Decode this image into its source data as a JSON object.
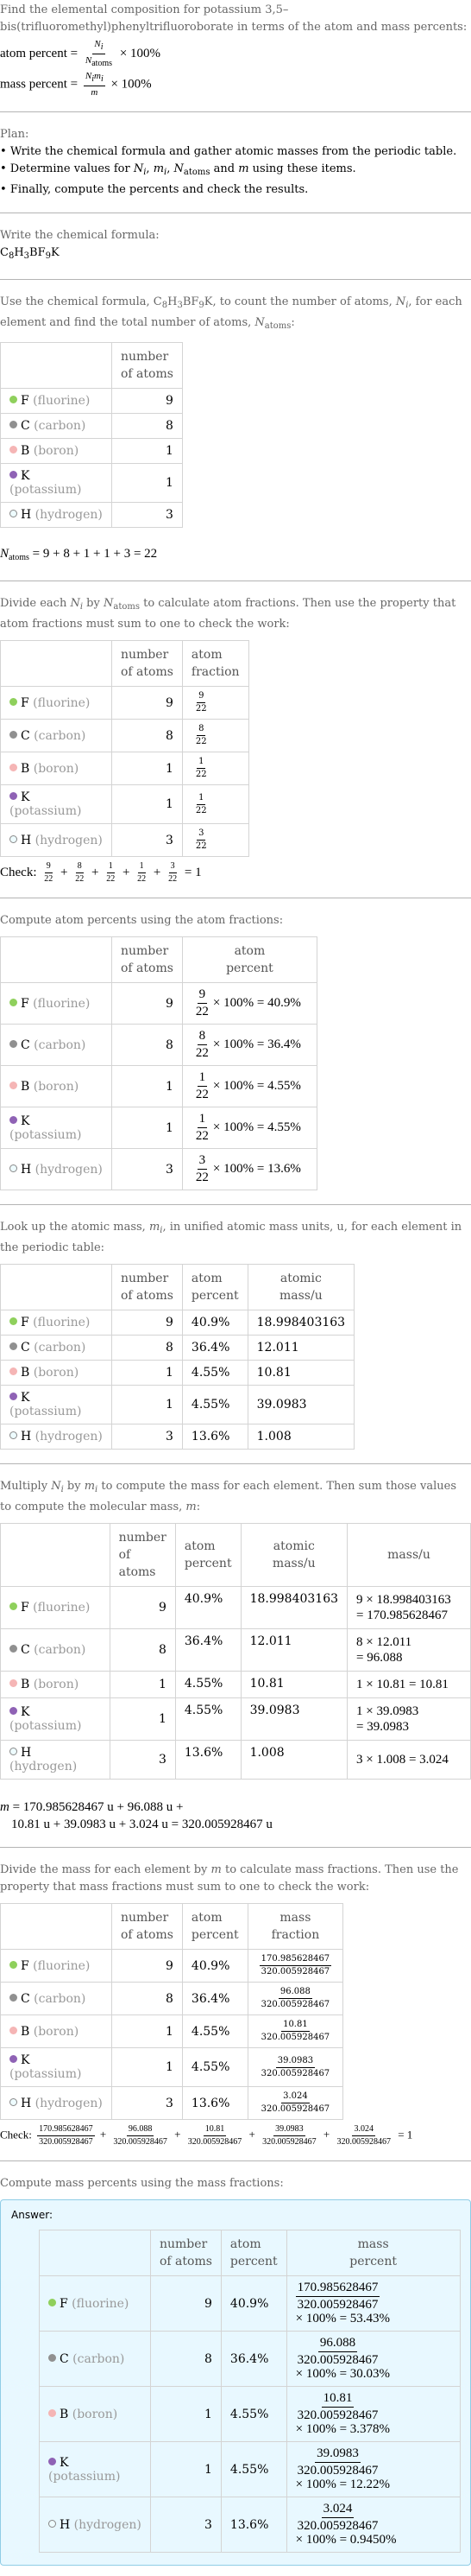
{
  "intro": {
    "question": "Find the elemental composition for potassium 3,5–bis(trifluoromethyl)phenyltrifluoroborate in terms of the atom and mass percents:",
    "atom_percent_label": "atom percent = ",
    "mass_percent_label": "mass percent = ",
    "times_100": " × 100%"
  },
  "plan": {
    "title": "Plan:",
    "items": [
      "Write the chemical formula and gather atomic masses from the periodic table.",
      "Determine values for Nᵢ, mᵢ, N_atoms and m using these items.",
      "Finally, compute the percents and check the results."
    ]
  },
  "formula_step": {
    "label": "Write the chemical formula:",
    "formula": "C8H3BF9K"
  },
  "count_step": {
    "text_a": "Use the chemical formula, ",
    "text_b": ", to count the number of atoms, ",
    "text_c": ", for each element and find the total number of atoms, ",
    "text_d": ":",
    "total_equation": " = 9 + 8 + 1 + 1 + 3 = 22"
  },
  "headers": {
    "number_of_atoms_1": "number",
    "number_of_atoms_2": "of atoms",
    "atom_fraction_1": "atom",
    "atom_fraction_2": "fraction",
    "atom_percent_1": "atom",
    "atom_percent_2": "percent",
    "atomic_mass_1": "atomic",
    "atomic_mass_2": "mass/u",
    "mass": "mass/u",
    "mass_fraction_1": "mass",
    "mass_fraction_2": "fraction",
    "mass_percent_1": "mass",
    "mass_percent_2": "percent"
  },
  "elements": [
    {
      "symbol": "F",
      "name": "(fluorine)",
      "color": "#8fd05c",
      "count": "9",
      "frac_n": "9",
      "frac_d": "22",
      "atom_percent_eq": "× 100% = 40.9%",
      "atom_percent": "40.9%",
      "atomic_mass": "18.998403163",
      "mass_eq_1": "9 × 18.998403163",
      "mass_eq_2": "= 170.985628467",
      "mass": "170.985628467",
      "mass_percent_eq": "× 100% = 53.43%"
    },
    {
      "symbol": "C",
      "name": "(carbon)",
      "color": "#909090",
      "count": "8",
      "frac_n": "8",
      "frac_d": "22",
      "atom_percent_eq": "× 100% = 36.4%",
      "atom_percent": "36.4%",
      "atomic_mass": "12.011",
      "mass_eq_1": "8 × 12.011",
      "mass_eq_2": "= 96.088",
      "mass": "96.088",
      "mass_percent_eq": "× 100% = 30.03%"
    },
    {
      "symbol": "B",
      "name": "(boron)",
      "color": "#f5b5b5",
      "count": "1",
      "frac_n": "1",
      "frac_d": "22",
      "atom_percent_eq": "× 100% = 4.55%",
      "atom_percent": "4.55%",
      "atomic_mass": "10.81",
      "mass_eq_1": "1 × 10.81 = 10.81",
      "mass_eq_2": "",
      "mass": "10.81",
      "mass_percent_eq": "× 100% = 3.378%"
    },
    {
      "symbol": "K",
      "name": "(potassium)",
      "color": "#8f62b5",
      "count": "1",
      "frac_n": "1",
      "frac_d": "22",
      "atom_percent_eq": "× 100% = 4.55%",
      "atom_percent": "4.55%",
      "atomic_mass": "39.0983",
      "mass_eq_1": "1 × 39.0983",
      "mass_eq_2": "= 39.0983",
      "mass": "39.0983",
      "mass_percent_eq": "× 100% = 12.22%"
    },
    {
      "symbol": "H",
      "name": "(hydrogen)",
      "color": "#eefcff",
      "count": "3",
      "frac_n": "3",
      "frac_d": "22",
      "atom_percent_eq": "× 100% = 13.6%",
      "atom_percent": "13.6%",
      "atomic_mass": "1.008",
      "mass_eq_1": "3 × 1.008 = 3.024",
      "mass_eq_2": "",
      "mass": "3.024",
      "mass_percent_eq": "× 100% = 0.9450%"
    }
  ],
  "fraction_step": {
    "text_a": "Divide each ",
    "text_b": " by ",
    "text_c": " to calculate atom fractions. Then use the property that atom fractions must sum to one to check the work:",
    "check_label": "Check: ",
    "check_result": " = 1"
  },
  "atom_percent_step": {
    "text": "Compute atom percents using the atom fractions:"
  },
  "mass_lookup_step": {
    "text_a": "Look up the atomic mass, ",
    "text_b": ", in unified atomic mass units, u, for each element in the periodic table:"
  },
  "mass_step": {
    "text_a": "Multiply ",
    "text_b": " by ",
    "text_c": " to compute the mass for each element. Then sum those values to compute the molecular mass, ",
    "text_d": ":",
    "total_line_1": " = 170.985628467 u + 96.088 u +",
    "total_line_2": "10.81 u + 39.0983 u + 3.024 u = 320.005928467 u"
  },
  "mass_fraction_step": {
    "text_a": "Divide the mass for each element by ",
    "text_b": " to calculate mass fractions. Then use the property that mass fractions must sum to one to check the work:",
    "denominator": "320.005928467",
    "check_label": "Check: ",
    "check_result": " = 1"
  },
  "mass_percent_step": {
    "text": "Compute mass percents using the mass fractions:",
    "answer_label": "Answer:"
  }
}
